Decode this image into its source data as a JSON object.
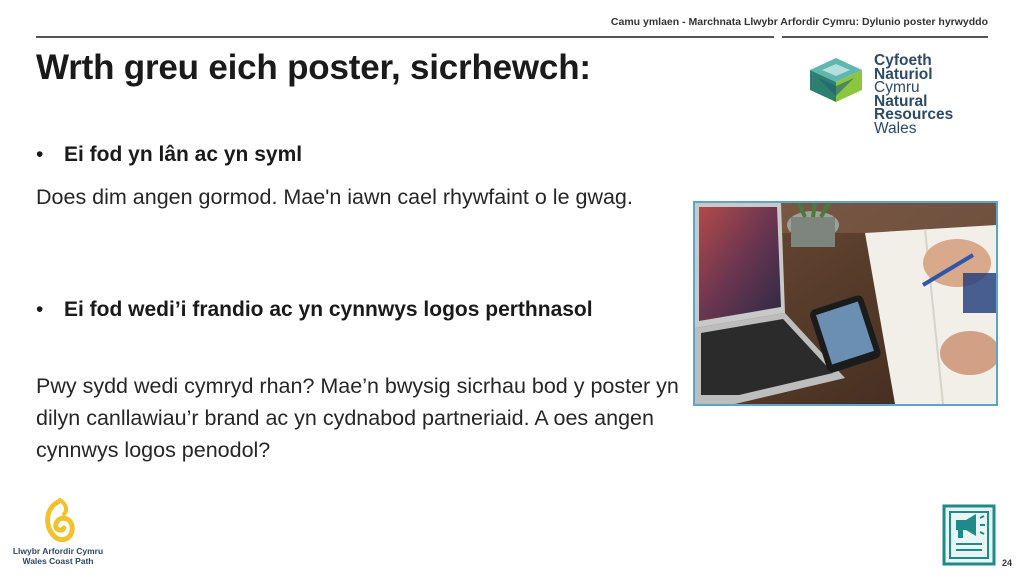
{
  "header": {
    "breadcrumb": "Camu ymlaen - Marchnata  Llwybr Arfordir Cymru: Dylunio poster hyrwyddo"
  },
  "title": "Wrth greu eich poster, sicrhewch:",
  "logo_nrw": {
    "line1": "Cyfoeth",
    "line2": "Naturiol",
    "line3": "Cymru",
    "line4": "Natural",
    "line5": "Resources",
    "line6": "Wales"
  },
  "content": {
    "bullet_glyph": "•",
    "items": [
      {
        "heading": "Ei fod yn lân ac yn syml",
        "body": "Does dim angen gormod. Mae'n iawn cael rhywfaint o le gwag."
      },
      {
        "heading": "Ei fod wedi’i frandio ac yn cynnwys logos perthnasol",
        "body": "Pwy sydd wedi cymryd rhan? Mae’n bwysig sicrhau bod y poster yn dilyn canllawiau’r brand ac yn cydnabod partneriaid. A oes angen cynnwys logos penodol?"
      }
    ]
  },
  "logo_wcp": {
    "line1": "Llwybr Arfordir Cymru",
    "line2": "Wales Coast Path"
  },
  "page_number": "24",
  "colors": {
    "accent_teal": "#1f8a8a",
    "photo_border": "#5aa6c8",
    "logo_text": "#2d4a66",
    "wcp_yellow": "#f2c12e"
  },
  "icons": {
    "megaphone": "megaphone-document-icon",
    "nrw": "nrw-cube-logo",
    "wcp": "wales-coast-path-logo"
  }
}
